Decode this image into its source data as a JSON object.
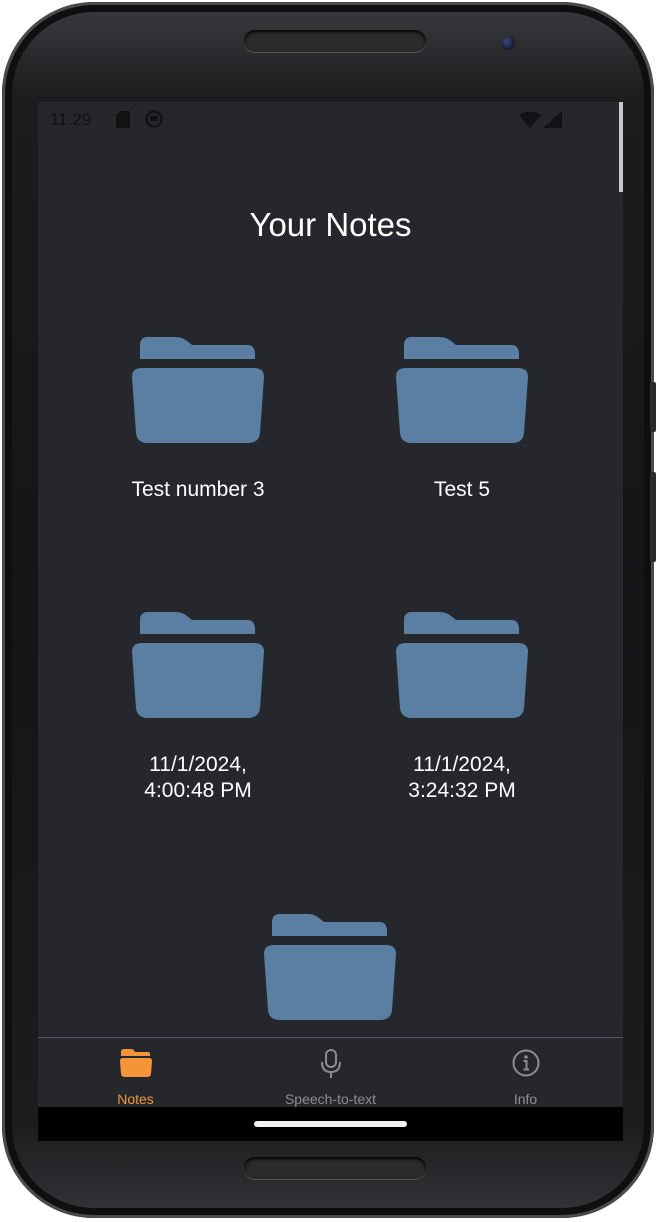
{
  "status_bar": {
    "time": "11:29",
    "left_icons": [
      "sim-card-icon",
      "app-notification-icon"
    ],
    "right_icons": [
      "wifi-icon",
      "cellular-signal-icon"
    ]
  },
  "page": {
    "title": "Your Notes"
  },
  "folders": [
    {
      "label": "Test number 3",
      "icon": "folder-icon"
    },
    {
      "label": "Test 5",
      "icon": "folder-icon"
    },
    {
      "label": "11/1/2024,\n4:00:48 PM",
      "icon": "folder-icon"
    },
    {
      "label": "11/1/2024,\n3:24:32 PM",
      "icon": "folder-icon"
    },
    {
      "label": "",
      "icon": "folder-icon"
    }
  ],
  "tab_bar": {
    "tabs": [
      {
        "label": "Notes",
        "icon": "folder-icon",
        "active": true
      },
      {
        "label": "Speech-to-text",
        "icon": "microphone-icon",
        "active": false
      },
      {
        "label": "Info",
        "icon": "info-icon",
        "active": false
      }
    ]
  },
  "colors": {
    "background": "#25272c",
    "folder": "#5a7fa3",
    "active_tab": "#f5953a",
    "inactive_tab": "#8b8d92",
    "text": "#ffffff"
  }
}
